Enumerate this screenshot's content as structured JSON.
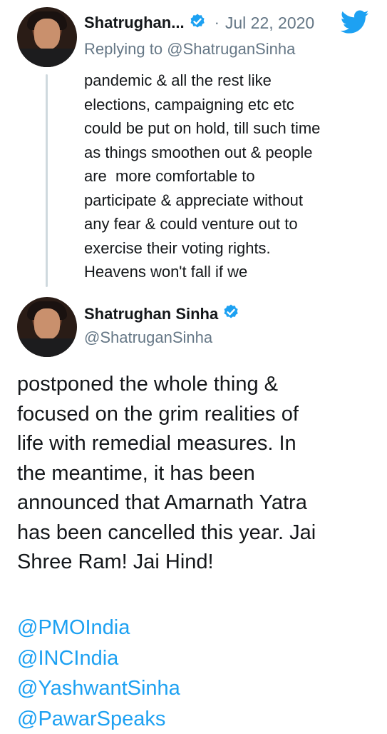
{
  "parent_tweet": {
    "author_name": "Shatrughan...",
    "date": "Jul 22, 2020",
    "separator": "·",
    "reply_prefix": "Replying to",
    "reply_to": "@ShatruganSinha",
    "text": "pandemic & all the rest like\nelections, campaigning etc etc\ncould be put on hold, till such time\nas things smoothen out & people\nare  more comfortable to\nparticipate & appreciate without\nany fear & could venture out to\nexercise their voting rights.\nHeavens won't fall if we"
  },
  "main_tweet": {
    "author_name": "Shatrughan Sinha",
    "handle": "@ShatruganSinha",
    "text": "postponed the whole thing &\nfocused on the grim realities of\nlife with remedial measures. In\nthe meantime, it has been\nannounced that Amarnath Yatra\nhas been cancelled this year. Jai\nShree Ram! Jai Hind!",
    "mentions": [
      "@PMOIndia",
      "@INCIndia",
      "@YashwantSinha",
      "@PawarSpeaks"
    ]
  },
  "colors": {
    "accent": "#1da1f2",
    "muted": "#657786",
    "text": "#14171a",
    "thread_line": "#cfd9de"
  },
  "icons": [
    "verified-badge-icon",
    "twitter-bird-icon"
  ]
}
